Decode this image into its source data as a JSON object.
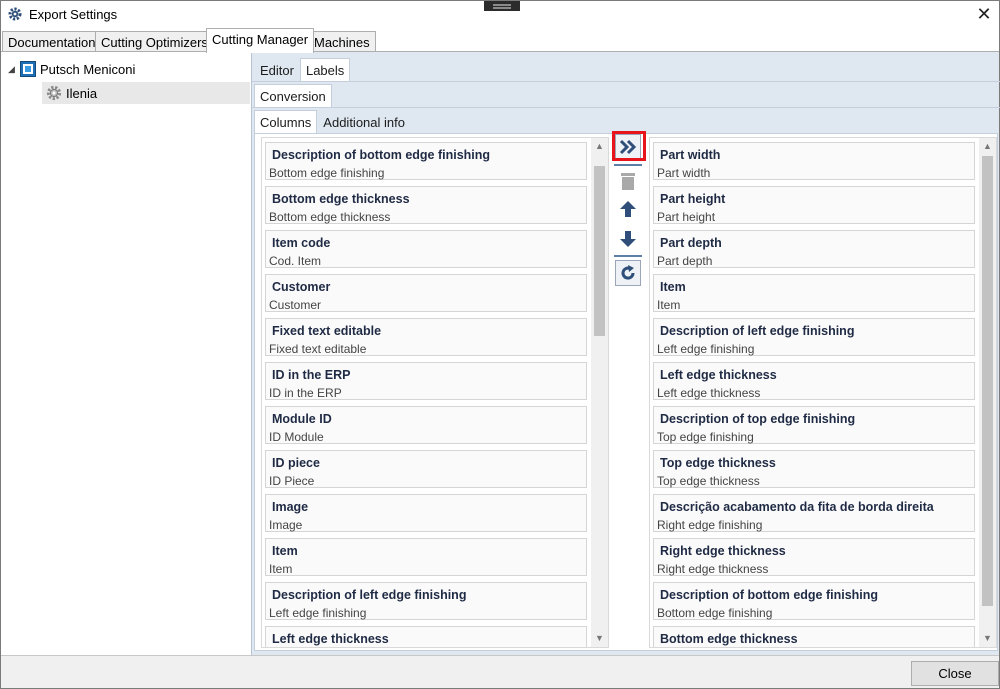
{
  "window": {
    "title": "Export Settings",
    "close_glyph": "✕"
  },
  "top_tabs": [
    "Documentation",
    "Cutting Optimizers",
    "Cutting Manager",
    "Machines"
  ],
  "active_top_tab": "Cutting Manager",
  "tree": {
    "root": {
      "label": "Putsch Meniconi",
      "icon": "machine-icon"
    },
    "child": {
      "label": "Ilenia",
      "icon": "gear-icon"
    }
  },
  "tabs_level1": [
    "Editor",
    "Labels"
  ],
  "tabs_level2": [
    "Conversion"
  ],
  "tabs_level3": [
    "Columns",
    "Additional info"
  ],
  "available_columns": [
    {
      "title": "Description of bottom edge finishing",
      "sub": "Bottom edge finishing"
    },
    {
      "title": "Bottom edge thickness",
      "sub": "Bottom edge thickness"
    },
    {
      "title": "Item code",
      "sub": "Cod. Item"
    },
    {
      "title": "Customer",
      "sub": "Customer"
    },
    {
      "title": "Fixed text editable",
      "sub": "Fixed text editable"
    },
    {
      "title": "ID in the ERP",
      "sub": "ID in the ERP"
    },
    {
      "title": "Module ID",
      "sub": "ID Module"
    },
    {
      "title": "ID piece",
      "sub": "ID Piece"
    },
    {
      "title": "Image",
      "sub": "Image"
    },
    {
      "title": "Item",
      "sub": "Item"
    },
    {
      "title": "Description of left edge finishing",
      "sub": "Left edge finishing"
    },
    {
      "title": "Left edge thickness",
      "sub": ""
    }
  ],
  "selected_columns": [
    {
      "title": "Part width",
      "sub": "Part width"
    },
    {
      "title": "Part height",
      "sub": "Part height"
    },
    {
      "title": "Part depth",
      "sub": "Part depth"
    },
    {
      "title": "Item",
      "sub": "Item"
    },
    {
      "title": "Description of left edge finishing",
      "sub": "Left edge finishing"
    },
    {
      "title": "Left edge thickness",
      "sub": "Left edge thickness"
    },
    {
      "title": "Description of top edge finishing",
      "sub": "Top edge finishing"
    },
    {
      "title": "Top edge thickness",
      "sub": "Top edge thickness"
    },
    {
      "title": "Descrição acabamento da fita de borda direita",
      "sub": "Right edge finishing"
    },
    {
      "title": "Right edge thickness",
      "sub": "Right edge thickness"
    },
    {
      "title": "Description of bottom edge finishing",
      "sub": "Bottom edge finishing"
    },
    {
      "title": "Bottom edge thickness",
      "sub": ""
    }
  ],
  "toolbar": {
    "add_all_icon": "double-chevron-right-icon",
    "delete_icon": "trash-icon",
    "move_up_icon": "arrow-up-icon",
    "move_down_icon": "arrow-down-icon",
    "reset_icon": "refresh-icon"
  },
  "close_button_label": "Close",
  "colors": {
    "accent": "#2f4f7a",
    "highlight": "#e8141c",
    "panel": "#dfe7f1"
  }
}
